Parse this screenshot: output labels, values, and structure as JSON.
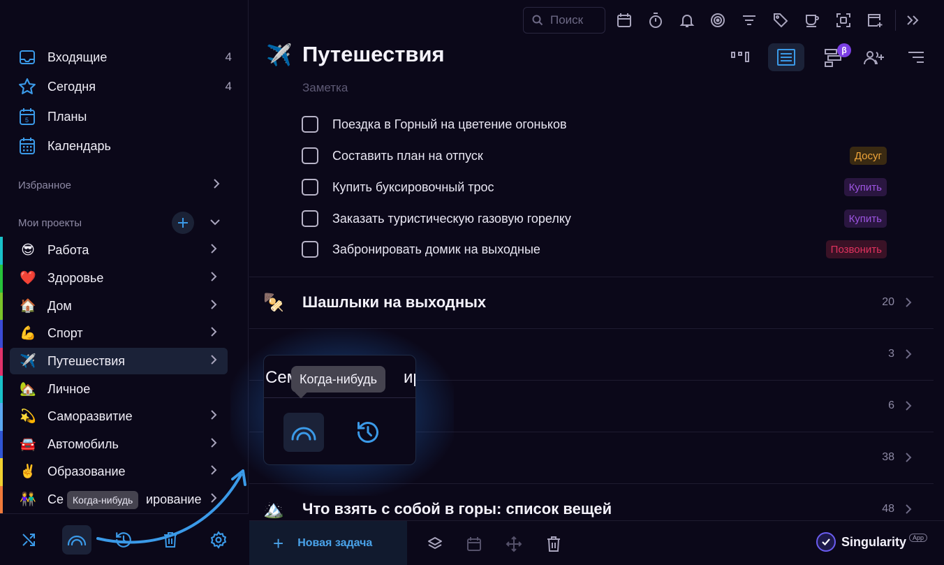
{
  "sidebar": {
    "nav": [
      {
        "label": "Входящие",
        "count": "4",
        "icon": "inbox-icon"
      },
      {
        "label": "Сегодня",
        "count": "4",
        "icon": "star-icon"
      },
      {
        "label": "Планы",
        "count": "",
        "icon": "calendar-day-icon"
      },
      {
        "label": "Календарь",
        "count": "",
        "icon": "calendar-grid-icon"
      }
    ],
    "favorites_label": "Избранное",
    "projects_label": "Мои проекты",
    "projects": [
      {
        "emoji": "😎",
        "label": "Работа",
        "color": "#19c1c9"
      },
      {
        "emoji": "❤️",
        "label": "Здоровье",
        "color": "#27c23b"
      },
      {
        "emoji": "🏠",
        "label": "Дом",
        "color": "#7ac32a"
      },
      {
        "emoji": "💪",
        "label": "Спорт",
        "color": "#3b4bd6"
      },
      {
        "emoji": "✈️",
        "label": "Путешествия",
        "color": "#e0326a"
      },
      {
        "emoji": "🏡",
        "label": "Личное",
        "color": "#19c1c9"
      },
      {
        "emoji": "💫",
        "label": "Саморазвитие",
        "color": "#5aa7f0"
      },
      {
        "emoji": "🚘",
        "label": "Автомобиль",
        "color": "#2f55d4"
      },
      {
        "emoji": "✌️",
        "label": "Образование",
        "color": "#f0d030"
      },
      {
        "emoji": "👫",
        "label": "Семейное планирование",
        "label_left": "Се",
        "label_right": "ирование",
        "color": "#f07a3a"
      }
    ],
    "tooltip": "Когда-нибудь"
  },
  "toolbar": {
    "search_placeholder": "Поиск"
  },
  "page": {
    "emoji": "✈️",
    "title": "Путешествия",
    "note": "Заметка",
    "tasks": [
      {
        "label": "Поездка в Горный на цветение огоньков",
        "tag": ""
      },
      {
        "label": "Составить план на отпуск",
        "tag": "Досуг",
        "tag_kind": "dosug"
      },
      {
        "label": "Купить буксировочный трос",
        "tag": "Купить",
        "tag_kind": "kupit"
      },
      {
        "label": "Заказать туристическую газовую горелку",
        "tag": "Купить",
        "tag_kind": "kupit"
      },
      {
        "label": "Забронировать домик на выходные",
        "tag": "Позвонить",
        "tag_kind": "zvon"
      }
    ],
    "groups": [
      {
        "emoji": "🍢",
        "title": "Шашлыки на выходных",
        "count": "20"
      },
      {
        "emoji": "",
        "title": "",
        "count": "3"
      },
      {
        "emoji": "",
        "title": "",
        "count": "6"
      },
      {
        "emoji": "",
        "title": "",
        "count": "38"
      },
      {
        "emoji": "🏔️",
        "title": "Что взять с собой в горы: список вещей",
        "count": "48"
      }
    ]
  },
  "popup": {
    "title_left": "Сем",
    "title_right": "ир",
    "tooltip": "Когда-нибудь"
  },
  "footer": {
    "new_task": "Новая задача",
    "brand": "Singularity",
    "brand_badge": "App"
  },
  "colors": {
    "accent": "#3b9ae8",
    "background": "#0b0819"
  }
}
